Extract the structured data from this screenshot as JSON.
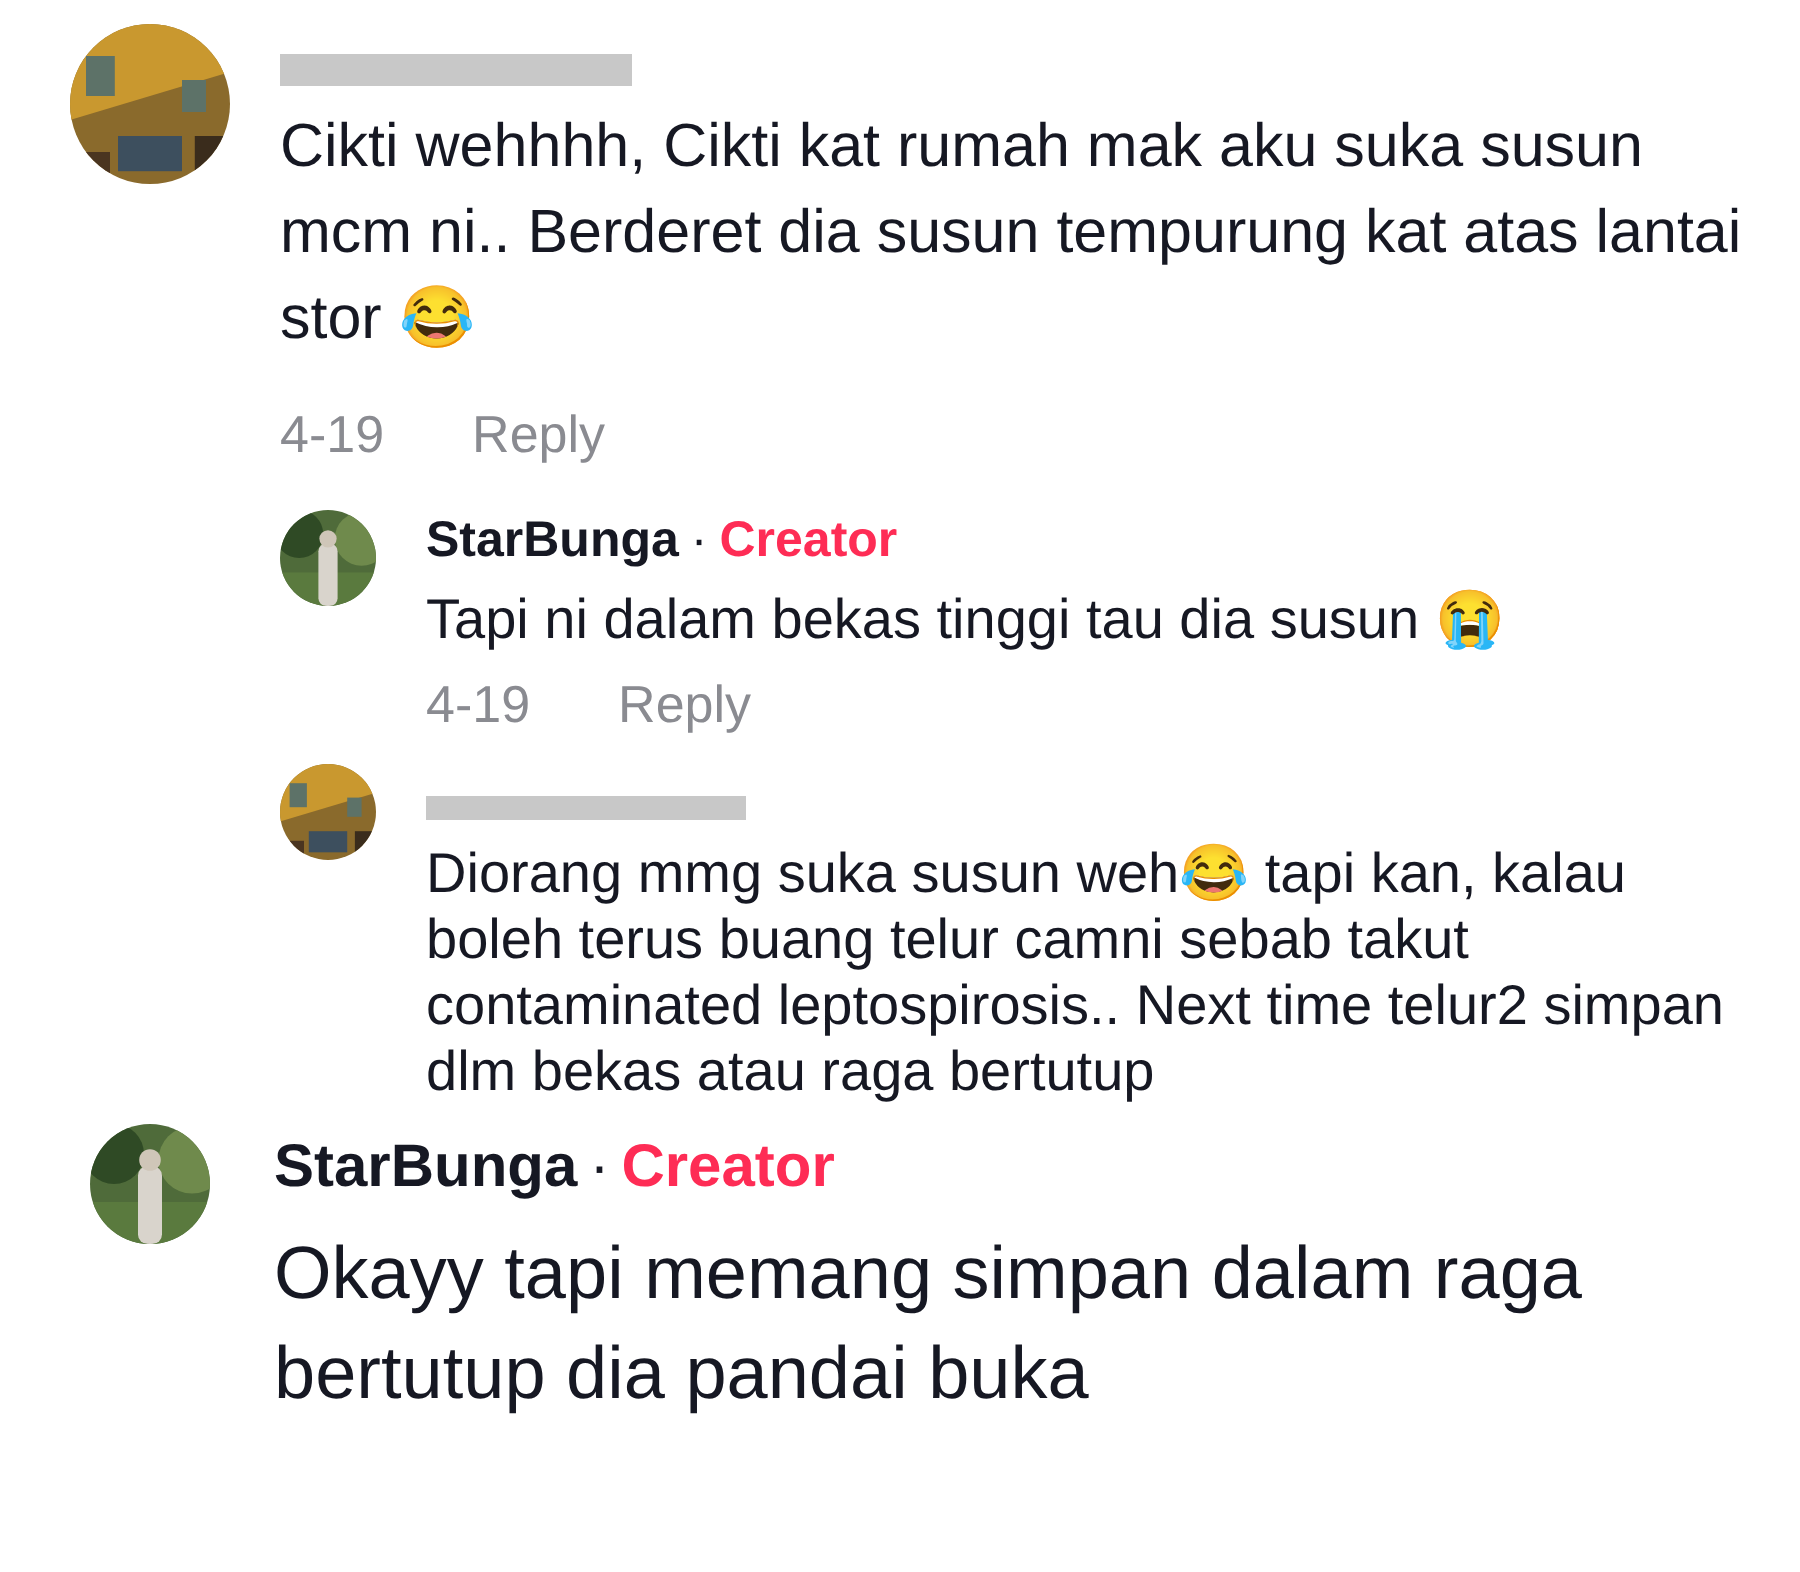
{
  "thread": {
    "author": {
      "name_redacted": true
    },
    "text": "Cikti wehhhh, Cikti kat rumah mak aku suka susun mcm ni.. Berderet dia susun tempurung kat atas lantai stor 😂",
    "date": "4-19",
    "reply_label": "Reply",
    "replies": [
      {
        "author": {
          "name": "StarBunga",
          "separator": "·",
          "badge": "Creator"
        },
        "text": "Tapi ni dalam bekas tinggi tau dia susun 😭",
        "date": "4-19",
        "reply_label": "Reply"
      },
      {
        "author": {
          "name_redacted": true
        },
        "text": "Diorang mmg suka susun weh😂 tapi kan, kalau boleh terus buang telur camni sebab takut contaminated leptospirosis.. Next time telur2 simpan dlm bekas atau raga bertutup"
      }
    ]
  },
  "bottom_comment": {
    "author": {
      "name": "StarBunga",
      "separator": "·",
      "badge": "Creator"
    },
    "text": "Okayy tapi memang simpan dalam raga bertutup dia pandai buka"
  }
}
